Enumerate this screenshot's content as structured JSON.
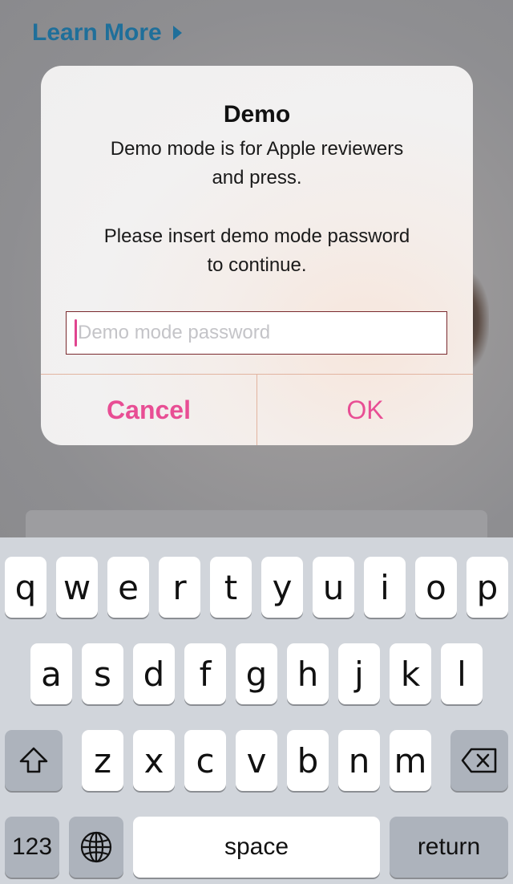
{
  "background": {
    "learn_more": "Learn More"
  },
  "alert": {
    "title": "Demo",
    "message_line1": "Demo mode is for Apple reviewers",
    "message_line2": "and press.",
    "message_line3": "Please insert demo mode password",
    "message_line4": "to continue.",
    "password_placeholder": "Demo mode password",
    "password_value": "",
    "cancel_label": "Cancel",
    "ok_label": "OK",
    "accent_color": "#e84e94"
  },
  "keyboard": {
    "row1": [
      "q",
      "w",
      "e",
      "r",
      "t",
      "y",
      "u",
      "i",
      "o",
      "p"
    ],
    "row2": [
      "a",
      "s",
      "d",
      "f",
      "g",
      "h",
      "j",
      "k",
      "l"
    ],
    "row3": [
      "z",
      "x",
      "c",
      "v",
      "b",
      "n",
      "m"
    ],
    "shift_icon": "shift-icon",
    "backspace_icon": "backspace-icon",
    "numbers_label": "123",
    "globe_icon": "globe-icon",
    "space_label": "space",
    "return_label": "return"
  }
}
